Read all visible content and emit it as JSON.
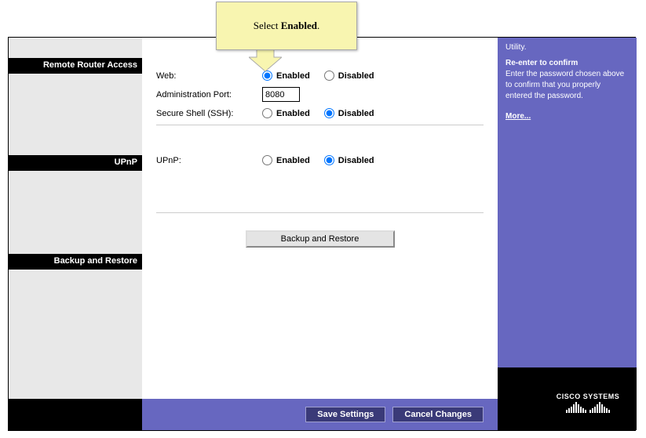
{
  "callout": {
    "prefix": "Select ",
    "bold": "Enabled",
    "suffix": "."
  },
  "sections": {
    "remote": "Remote Router Access",
    "upnp": "UPnP",
    "backup": "Backup and Restore"
  },
  "form": {
    "web": {
      "label": "Web:",
      "enabled": "Enabled",
      "disabled": "Disabled"
    },
    "port": {
      "label": "Administration Port:",
      "value": "8080"
    },
    "ssh": {
      "label": "Secure Shell (SSH):",
      "enabled": "Enabled",
      "disabled": "Disabled"
    },
    "upnp": {
      "label": "UPnP:",
      "enabled": "Enabled",
      "disabled": "Disabled"
    },
    "backup_btn": "Backup and Restore"
  },
  "help": {
    "line0_suffix": "Utility.",
    "subhead": "Re-enter to confirm",
    "body": "Enter the password chosen above to confirm that you properly entered the password.",
    "more": "More..."
  },
  "buttons": {
    "save": "Save Settings",
    "cancel": "Cancel Changes"
  },
  "brand": "CISCO SYSTEMS"
}
